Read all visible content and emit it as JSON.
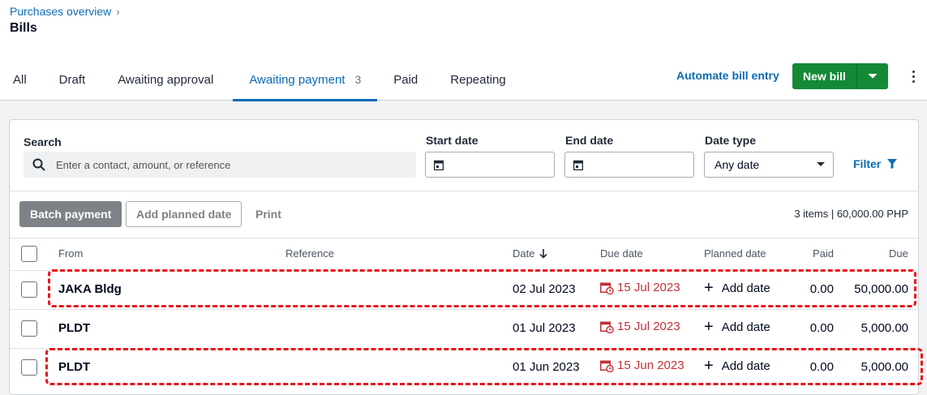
{
  "breadcrumb": {
    "parent": "Purchases overview"
  },
  "page_title": "Bills",
  "tabs": [
    {
      "label": "All"
    },
    {
      "label": "Draft"
    },
    {
      "label": "Awaiting approval"
    },
    {
      "label": "Awaiting payment",
      "count": "3"
    },
    {
      "label": "Paid"
    },
    {
      "label": "Repeating"
    }
  ],
  "active_tab": "Awaiting payment",
  "actions": {
    "automate": "Automate bill entry",
    "new_bill": "New bill"
  },
  "filters": {
    "search_label": "Search",
    "search_placeholder": "Enter a contact, amount, or reference",
    "start_date_label": "Start date",
    "end_date_label": "End date",
    "date_type_label": "Date type",
    "date_type_value": "Any date",
    "filter_label": "Filter"
  },
  "toolbar": {
    "batch_payment": "Batch payment",
    "add_planned_date": "Add planned date",
    "print": "Print",
    "summary": "3 items | 60,000.00 PHP"
  },
  "table": {
    "headers": {
      "from": "From",
      "reference": "Reference",
      "date": "Date",
      "due_date": "Due date",
      "planned_date": "Planned date",
      "paid": "Paid",
      "due": "Due"
    },
    "rows": [
      {
        "from": "JAKA Bldg",
        "reference": "",
        "date": "02 Jul 2023",
        "due_date": "15 Jul 2023",
        "planned": "Add date",
        "paid": "0.00",
        "due": "50,000.00",
        "highlighted": true
      },
      {
        "from": "PLDT",
        "reference": "",
        "date": "01 Jul 2023",
        "due_date": "15 Jul 2023",
        "planned": "Add date",
        "paid": "0.00",
        "due": "5,000.00",
        "highlighted": false
      },
      {
        "from": "PLDT",
        "reference": "",
        "date": "01 Jun 2023",
        "due_date": "15 Jun 2023",
        "planned": "Add date",
        "paid": "0.00",
        "due": "5,000.00",
        "highlighted": true
      }
    ]
  },
  "colors": {
    "accent": "#0c6bb5",
    "primary_button": "#138a36",
    "overdue": "#c2303a",
    "annotation": "#e8141b"
  }
}
